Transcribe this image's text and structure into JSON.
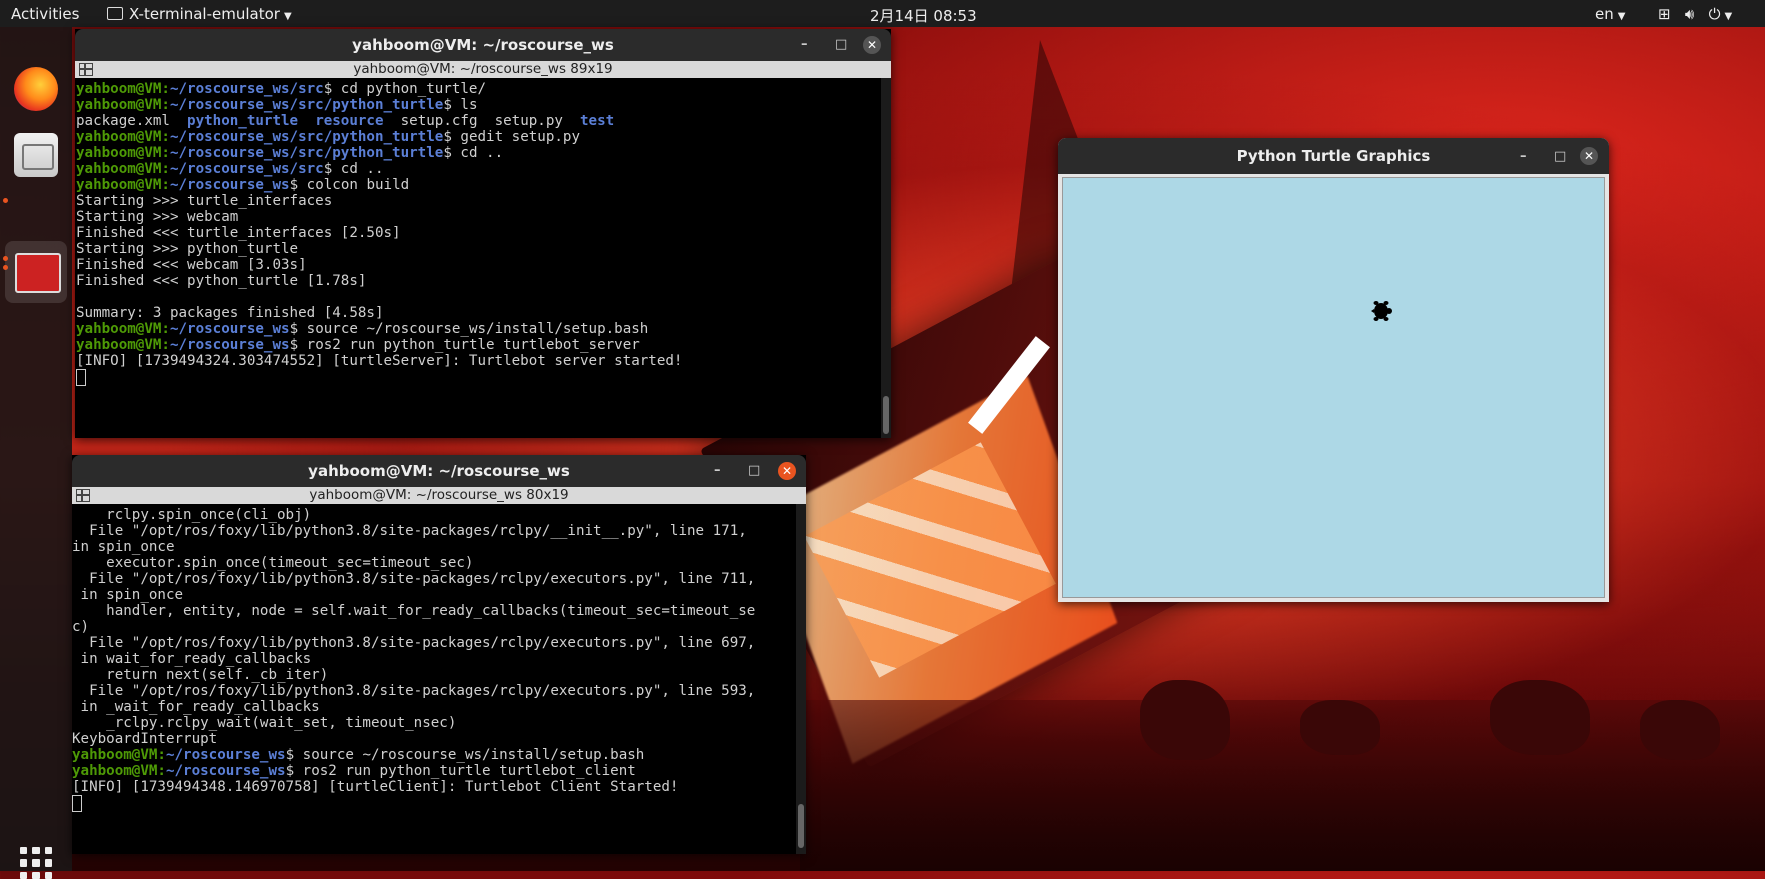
{
  "topbar": {
    "activities": "Activities",
    "app_name": "X-terminal-emulator",
    "clock": "2月14日  08:53",
    "lang": "en",
    "system_icons": [
      "network-icon",
      "volume-icon",
      "power-icon"
    ]
  },
  "dock": {
    "apps": [
      "firefox-icon",
      "files-icon",
      "terminal-icon"
    ],
    "show_apps": "apps-grid-icon"
  },
  "terminal1": {
    "title": "yahboom@VM: ~/roscourse_ws",
    "subtitle": "yahboom@VM: ~/roscourse_ws 89x19",
    "lines": [
      {
        "user": "yahboom@VM",
        "path": "~/roscourse_ws/src",
        "cmd": " cd python_turtle/"
      },
      {
        "user": "yahboom@VM",
        "path": "~/roscourse_ws/src/python_turtle",
        "cmd": " ls"
      },
      {
        "out": "package.xml  ",
        "d1": "python_turtle",
        "s1": "  ",
        "d2": "resource",
        "s2": "  setup.cfg  setup.py  ",
        "d3": "test"
      },
      {
        "user": "yahboom@VM",
        "path": "~/roscourse_ws/src/python_turtle",
        "cmd": " gedit setup.py"
      },
      {
        "user": "yahboom@VM",
        "path": "~/roscourse_ws/src/python_turtle",
        "cmd": " cd .."
      },
      {
        "user": "yahboom@VM",
        "path": "~/roscourse_ws/src",
        "cmd": " cd .."
      },
      {
        "user": "yahboom@VM",
        "path": "~/roscourse_ws",
        "cmd": " colcon build"
      },
      {
        "out": "Starting >>> turtle_interfaces"
      },
      {
        "out": "Starting >>> webcam"
      },
      {
        "out": "Finished <<< turtle_interfaces [2.50s]"
      },
      {
        "out": "Starting >>> python_turtle"
      },
      {
        "out": "Finished <<< webcam [3.03s]"
      },
      {
        "out": "Finished <<< python_turtle [1.78s]"
      },
      {
        "out": ""
      },
      {
        "out": "Summary: 3 packages finished [4.58s]"
      },
      {
        "user": "yahboom@VM",
        "path": "~/roscourse_ws",
        "cmd": " source ~/roscourse_ws/install/setup.bash"
      },
      {
        "user": "yahboom@VM",
        "path": "~/roscourse_ws",
        "cmd": " ros2 run python_turtle turtlebot_server"
      },
      {
        "out": "[INFO] [1739494324.303474552] [turtleServer]: Turtlebot server started!"
      }
    ]
  },
  "terminal2": {
    "title": "yahboom@VM: ~/roscourse_ws",
    "subtitle": "yahboom@VM: ~/roscourse_ws 80x19",
    "lines": [
      {
        "out": "    rclpy.spin_once(cli_obj)"
      },
      {
        "out": "  File \"/opt/ros/foxy/lib/python3.8/site-packages/rclpy/__init__.py\", line 171,"
      },
      {
        "out": "in spin_once"
      },
      {
        "out": "    executor.spin_once(timeout_sec=timeout_sec)"
      },
      {
        "out": "  File \"/opt/ros/foxy/lib/python3.8/site-packages/rclpy/executors.py\", line 711,"
      },
      {
        "out": " in spin_once"
      },
      {
        "out": "    handler, entity, node = self.wait_for_ready_callbacks(timeout_sec=timeout_se"
      },
      {
        "out": "c)"
      },
      {
        "out": "  File \"/opt/ros/foxy/lib/python3.8/site-packages/rclpy/executors.py\", line 697,"
      },
      {
        "out": " in wait_for_ready_callbacks"
      },
      {
        "out": "    return next(self._cb_iter)"
      },
      {
        "out": "  File \"/opt/ros/foxy/lib/python3.8/site-packages/rclpy/executors.py\", line 593,"
      },
      {
        "out": " in _wait_for_ready_callbacks"
      },
      {
        "out": "    _rclpy.rclpy_wait(wait_set, timeout_nsec)"
      },
      {
        "out": "KeyboardInterrupt"
      },
      {
        "user": "yahboom@VM",
        "path": "~/roscourse_ws",
        "cmd": " source ~/roscourse_ws/install/setup.bash"
      },
      {
        "user": "yahboom@VM",
        "path": "~/roscourse_ws",
        "cmd": " ros2 run python_turtle turtlebot_client"
      },
      {
        "out": "[INFO] [1739494348.146970758] [turtleClient]: Turtlebot Client Started!"
      }
    ]
  },
  "turtle_window": {
    "title": "Python Turtle Graphics",
    "canvas_color": "#add8e6",
    "turtle_icon": "turtle-icon"
  },
  "window_controls": {
    "minimize": "–",
    "maximize": "□",
    "close": "✕"
  }
}
